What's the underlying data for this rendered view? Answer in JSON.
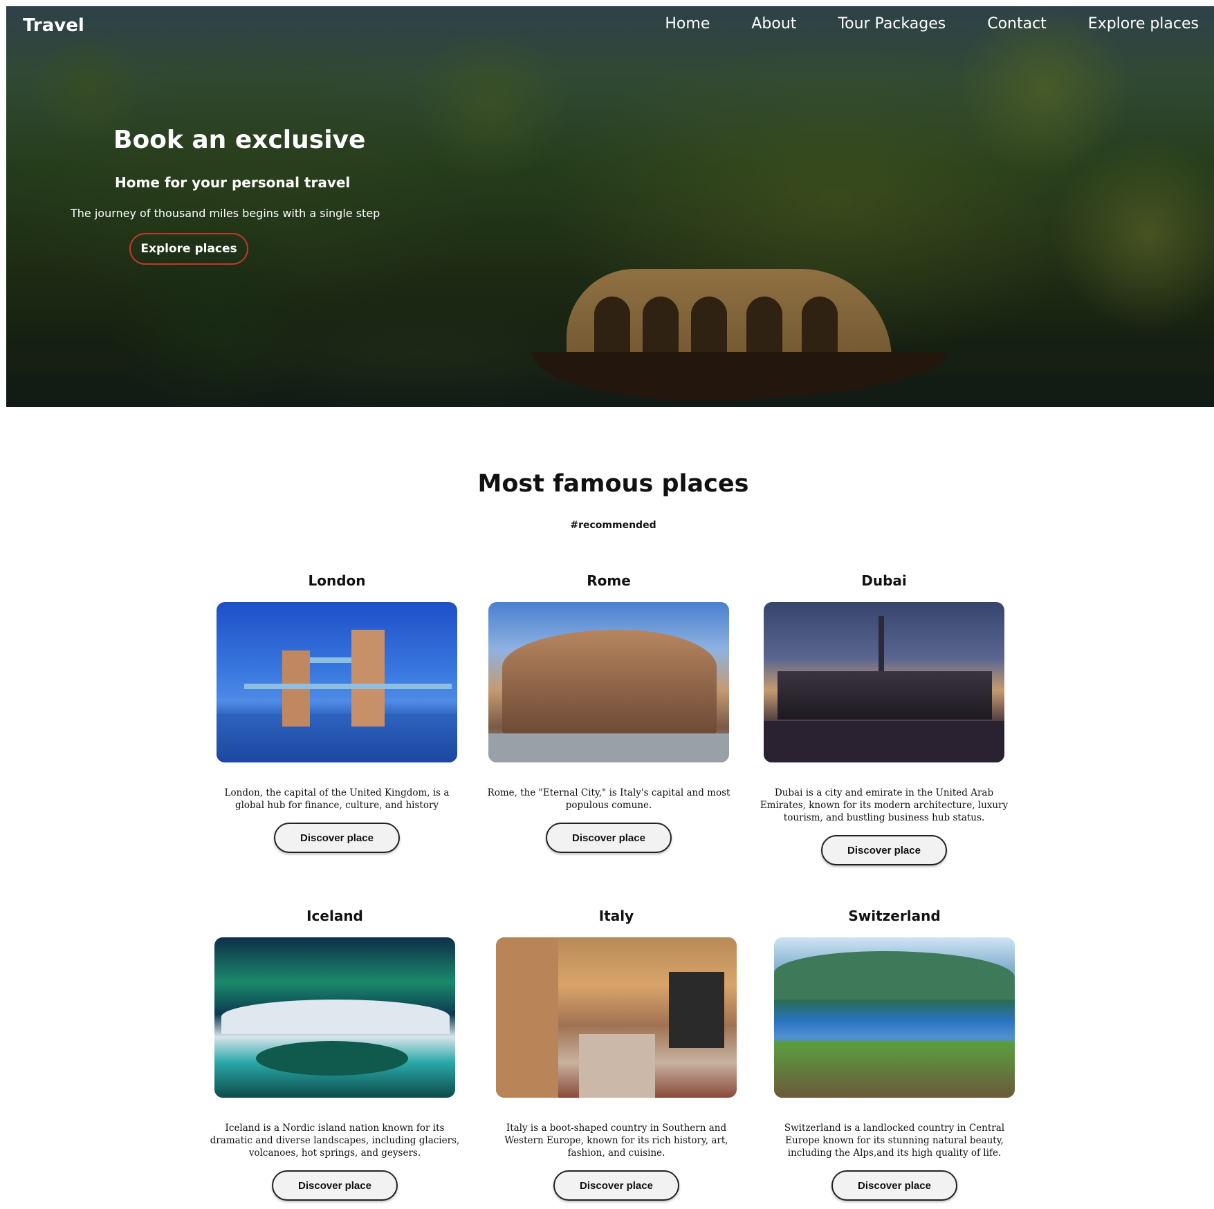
{
  "header": {
    "brand": "Travel",
    "nav": [
      "Home",
      "About",
      "Tour Packages",
      "Contact",
      "Explore places"
    ]
  },
  "hero": {
    "title": "Book an exclusive",
    "subtitle": "Home for your personal travel",
    "tagline": "The journey of thousand miles begins with a single step",
    "button": "Explore places"
  },
  "section": {
    "title": "Most famous places",
    "tag": "#recommended"
  },
  "places": [
    {
      "name": "London",
      "description": "London, the capital of the United Kingdom, is a global hub for finance, culture, and history",
      "button": "Discover place"
    },
    {
      "name": "Rome",
      "description": "Rome, the \"Eternal City,\" is Italy's capital and most populous comune.",
      "button": "Discover place"
    },
    {
      "name": "Dubai",
      "description": "Dubai is a city and emirate in the United Arab Emirates, known for its modern architecture, luxury tourism, and bustling business hub status.",
      "button": "Discover place"
    },
    {
      "name": "Iceland",
      "description": "Iceland is a Nordic island nation known for its dramatic and diverse landscapes, including glaciers, volcanoes, hot springs, and geysers.",
      "button": "Discover place"
    },
    {
      "name": "Italy",
      "description": "Italy is a boot-shaped country in Southern and Western Europe, known for its rich history, art, fashion, and cuisine.",
      "button": "Discover place"
    },
    {
      "name": "Switzerland",
      "description": "Switzerland is a landlocked country in Central Europe known for its stunning natural beauty, including the Alps,and its high quality of life.",
      "button": "Discover place"
    }
  ]
}
